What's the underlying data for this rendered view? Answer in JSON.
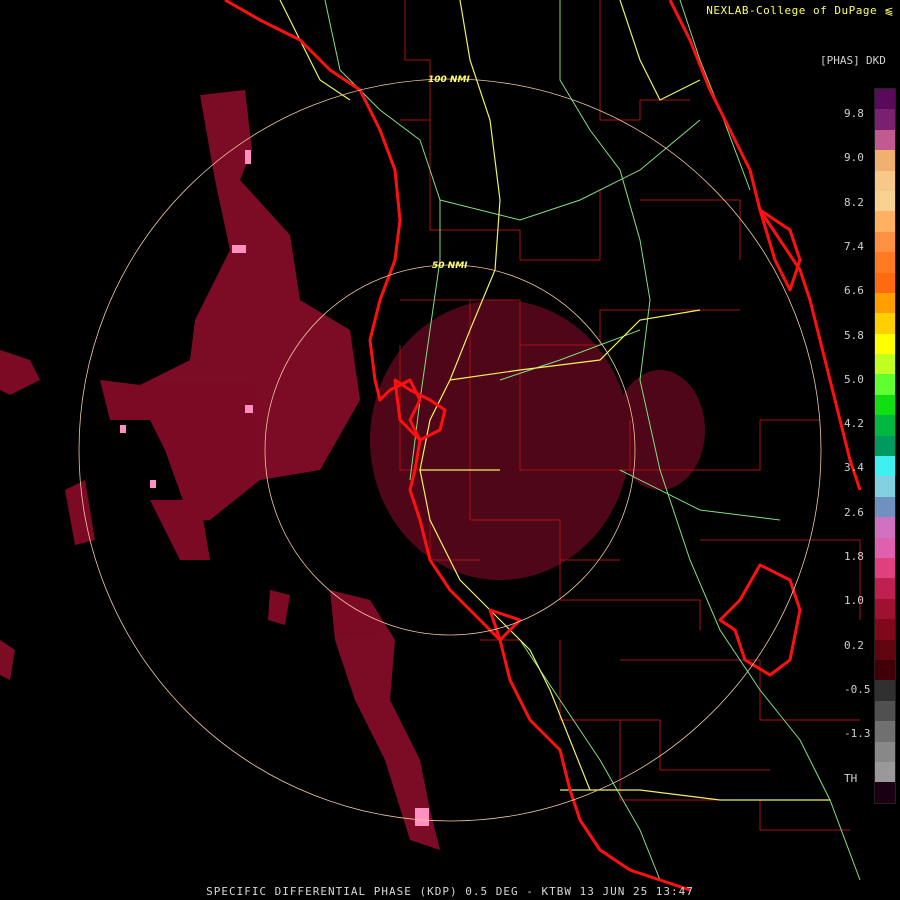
{
  "header": {
    "credit": "NEXLAB-College of DuPage"
  },
  "footer": {
    "caption": "SPECIFIC DIFFERENTIAL PHASE (KDP) 0.5 DEG - KTBW 13 JUN 25 13:47"
  },
  "range_rings": {
    "inner_label": "50 NMI",
    "outer_label": "100 NMI"
  },
  "legend": {
    "unit": "[PHAS]",
    "product": "DKD",
    "ticks": [
      "9.8",
      "9.0",
      "8.2",
      "7.4",
      "6.6",
      "5.8",
      "5.0",
      "4.2",
      "3.4",
      "2.6",
      "1.8",
      "1.0",
      "0.2",
      "-0.5",
      "-1.3",
      "TH"
    ],
    "colors": [
      "#5a0a5a",
      "#7a2070",
      "#c05a90",
      "#f0b070",
      "#f8c88a",
      "#f8d090",
      "#ffb060",
      "#ff9040",
      "#ff7a20",
      "#ff6a10",
      "#ffa000",
      "#ffd000",
      "#ffff00",
      "#c0ff20",
      "#60ff30",
      "#10e010",
      "#00b840",
      "#009a60",
      "#40f0f0",
      "#80d0e0",
      "#7090c0",
      "#d070c0",
      "#e060b0",
      "#e04080",
      "#c02050",
      "#a01030",
      "#800818",
      "#600410",
      "#400008",
      "#303030",
      "#505050",
      "#707070",
      "#888888",
      "#999999",
      "#1a0010"
    ]
  },
  "colors": {
    "coastline": "#ff1010",
    "county_lines": "#a81010",
    "highways": "#f0f060",
    "roads": "#80e080",
    "range_rings": "#f0c8a0",
    "echo": "#9a1030",
    "echo_bright": "#ff90c0"
  }
}
